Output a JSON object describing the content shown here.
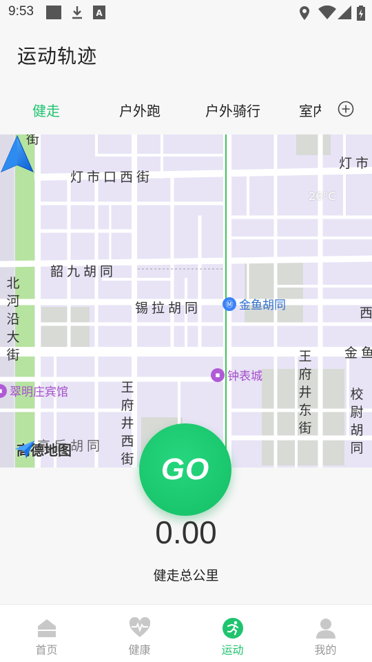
{
  "status_bar": {
    "time": "9:53",
    "left_icons": [
      "image-icon",
      "download-icon",
      "font-a-icon"
    ],
    "right_icons": [
      "location-icon",
      "wifi-icon",
      "signal-icon",
      "battery-charging-icon"
    ]
  },
  "header": {
    "title": "运动轨迹"
  },
  "tabs": {
    "items": [
      {
        "label": "健走",
        "active": true
      },
      {
        "label": "户外跑",
        "active": false
      },
      {
        "label": "户外骑行",
        "active": false
      },
      {
        "label": "室内",
        "active": false
      }
    ],
    "add_icon": "plus-circle-icon"
  },
  "map": {
    "labels": {
      "dengshikou": "灯市口西街",
      "dengshi_right": "灯市",
      "shaojiu": "韶九胡同",
      "xila": "锡拉胡同",
      "beiheyan": "北河沿大街",
      "wangfujing_west": "王府井西街",
      "wangfujing_east": "王府井东街",
      "xiaowei": "校尉胡同",
      "gaodeng": "高后胡同",
      "jie_top": "街",
      "xi_right": "西",
      "jinyu_right": "金鱼"
    },
    "temperature": "26°C",
    "pois": {
      "subway": {
        "name": "金鱼胡同",
        "icon": "subway-icon",
        "color": "#3b82f6"
      },
      "mall": {
        "name": "钟表城",
        "icon": "shopping-icon",
        "color": "#b05bd6"
      },
      "hotel": {
        "name": "翠明庄宾馆",
        "icon": "hotel-icon",
        "color": "#b05bd6"
      }
    },
    "logo": {
      "name": "高德地图",
      "icon": "amap-logo-icon"
    },
    "location_icon": "navigation-arrow-icon"
  },
  "go_button": {
    "label": "GO"
  },
  "stats": {
    "distance": "0.00",
    "distance_label": "健走总公里"
  },
  "bottom_nav": [
    {
      "label": "首页",
      "icon": "home-icon",
      "active": false
    },
    {
      "label": "健康",
      "icon": "heart-rate-icon",
      "active": false
    },
    {
      "label": "运动",
      "icon": "running-icon",
      "active": true
    },
    {
      "label": "我的",
      "icon": "person-icon",
      "active": false
    }
  ],
  "colors": {
    "accent": "#1ec46e",
    "map_background": "#e8e4f6",
    "road": "#ffffff",
    "park": "#b6e3a0"
  }
}
